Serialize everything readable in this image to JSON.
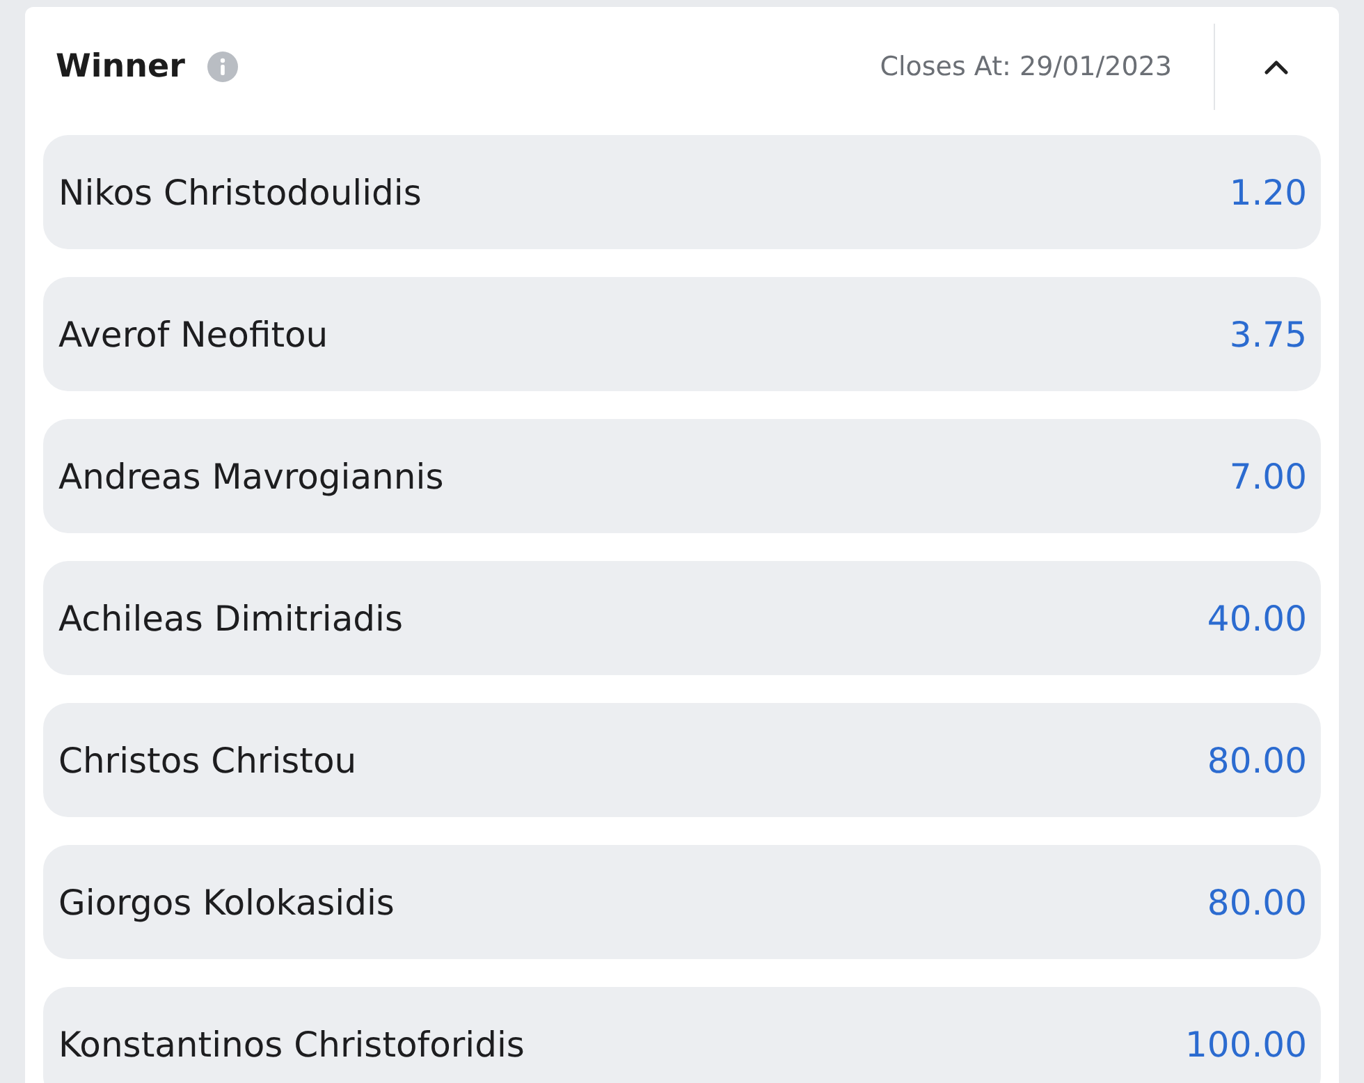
{
  "market": {
    "title": "Winner",
    "closes": "Closes At: 29/01/2023",
    "expanded": true
  },
  "selections": [
    {
      "name": "Nikos Christodoulidis",
      "odds": "1.20"
    },
    {
      "name": "Averof Neofitou",
      "odds": "3.75"
    },
    {
      "name": "Andreas Mavrogiannis",
      "odds": "7.00"
    },
    {
      "name": "Achileas Dimitriadis",
      "odds": "40.00"
    },
    {
      "name": "Christos Christou",
      "odds": "80.00"
    },
    {
      "name": "Giorgos Kolokasidis",
      "odds": "80.00"
    },
    {
      "name": "Konstantinos Christoforidis",
      "odds": "100.00"
    }
  ]
}
